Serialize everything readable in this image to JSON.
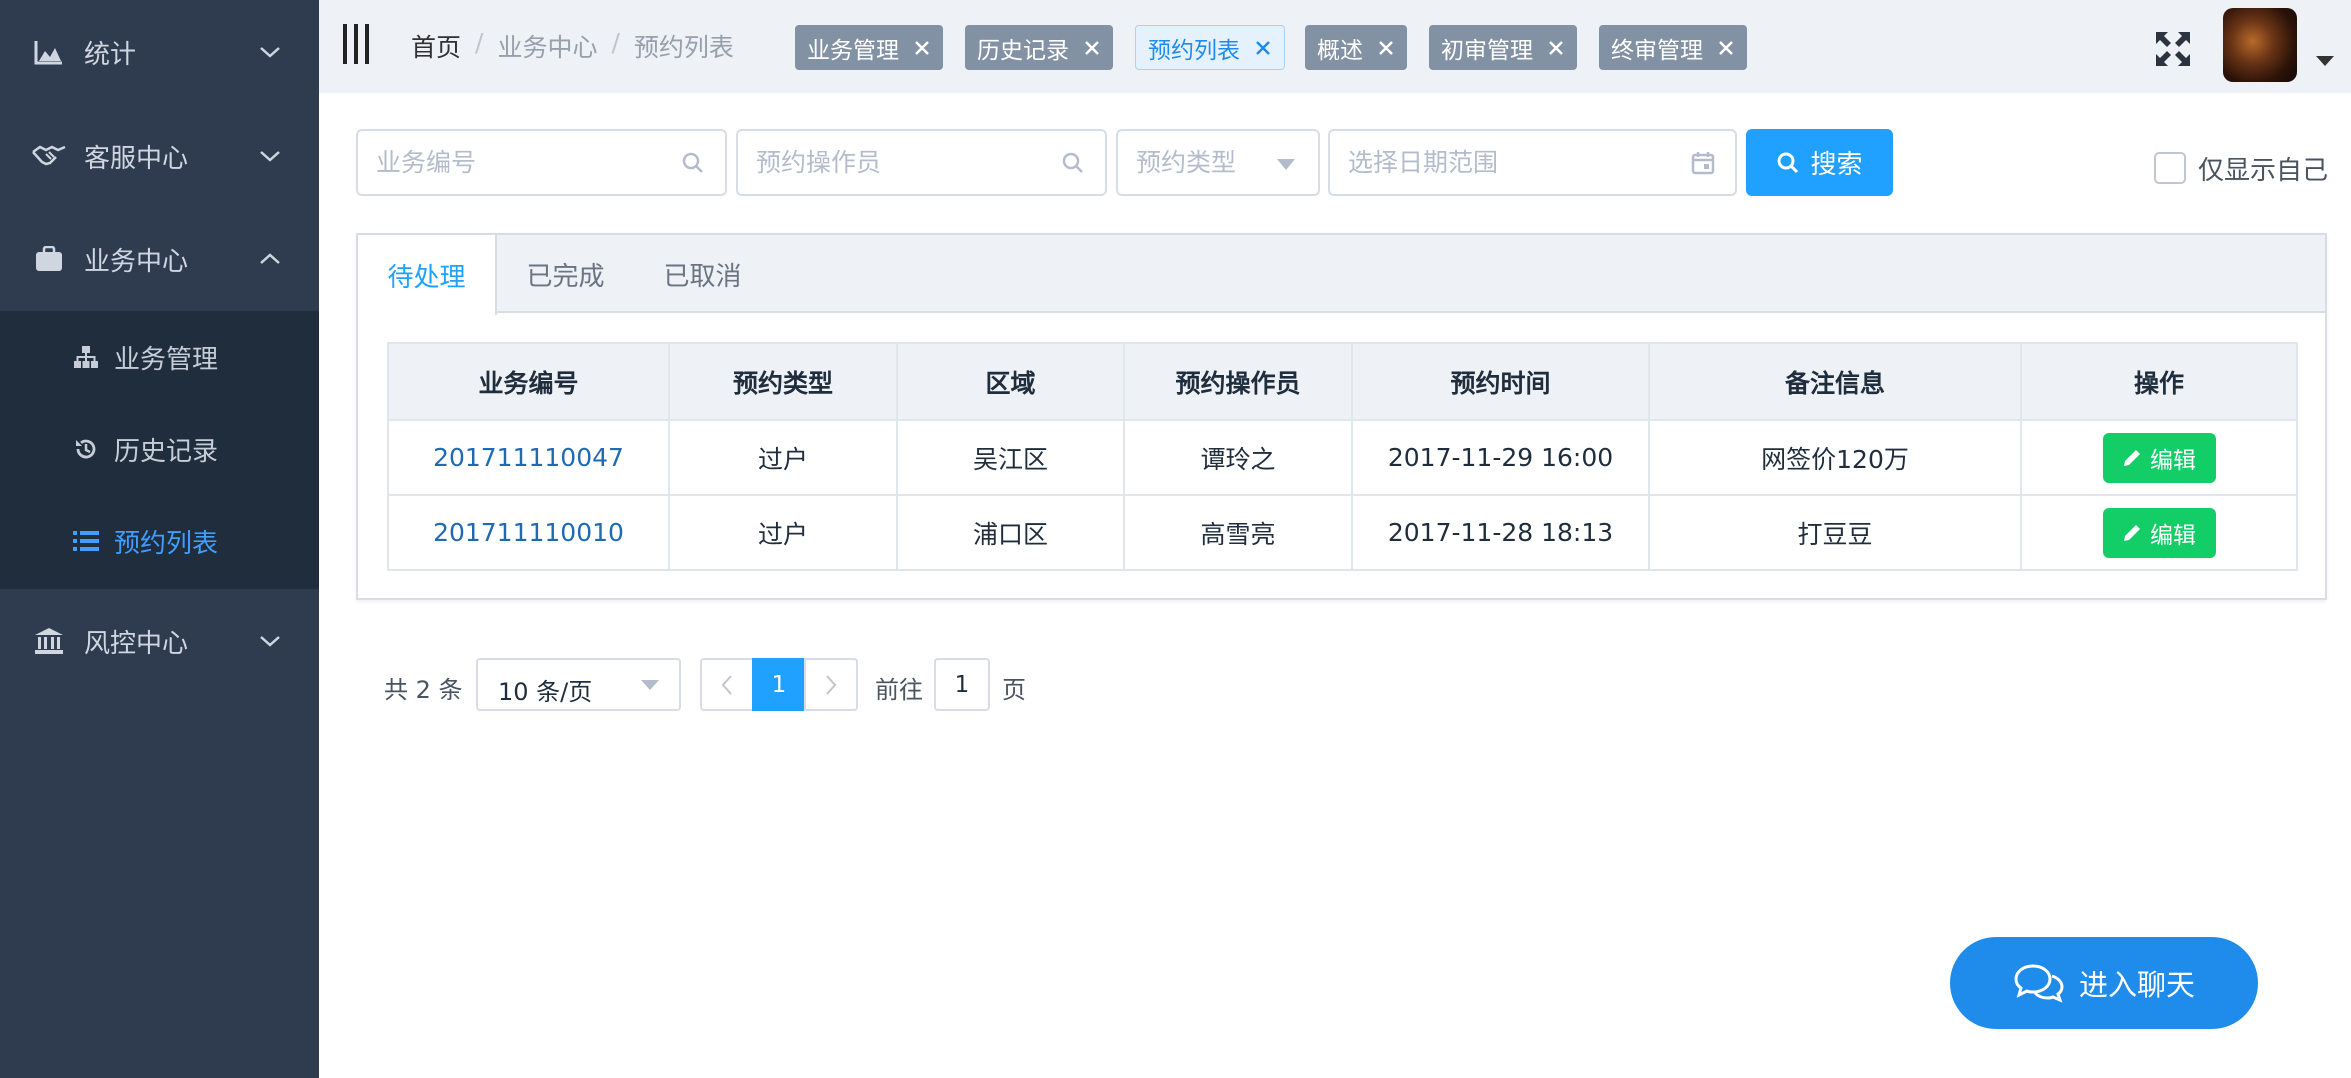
{
  "sidebar": {
    "items": [
      {
        "label": "统计",
        "icon": "area-chart-icon",
        "expanded": false
      },
      {
        "label": "客服中心",
        "icon": "handshake-icon",
        "expanded": false
      },
      {
        "label": "业务中心",
        "icon": "briefcase-icon",
        "expanded": true
      },
      {
        "label": "风控中心",
        "icon": "bank-icon",
        "expanded": false
      }
    ],
    "submenu": [
      {
        "label": "业务管理",
        "icon": "sitemap-icon"
      },
      {
        "label": "历史记录",
        "icon": "history-icon"
      },
      {
        "label": "预约列表",
        "icon": "list-icon",
        "active": true
      }
    ]
  },
  "header": {
    "breadcrumb": [
      "首页",
      "业务中心",
      "预约列表"
    ],
    "breadcrumb_sep": "/",
    "tags": [
      {
        "label": "业务管理"
      },
      {
        "label": "历史记录"
      },
      {
        "label": "预约列表",
        "active": true
      },
      {
        "label": "概述"
      },
      {
        "label": "初审管理"
      },
      {
        "label": "终审管理"
      }
    ]
  },
  "filters": {
    "business_no_placeholder": "业务编号",
    "operator_placeholder": "预约操作员",
    "type_placeholder": "预约类型",
    "date_placeholder": "选择日期范围",
    "search_label": "搜索",
    "only_self_label": "仅显示自己"
  },
  "tabs": [
    "待处理",
    "已完成",
    "已取消"
  ],
  "table": {
    "columns": [
      "业务编号",
      "预约类型",
      "区域",
      "预约操作员",
      "预约时间",
      "备注信息",
      "操作"
    ],
    "rows": [
      [
        "201711110047",
        "过户",
        "吴江区",
        "谭玲之",
        "2017-11-29 16:00",
        "网签价120万"
      ],
      [
        "201711110010",
        "过户",
        "浦口区",
        "高雪亮",
        "2017-11-28 18:13",
        "打豆豆"
      ]
    ],
    "edit_label": "编辑"
  },
  "pagination": {
    "total_text": "共 2 条",
    "page_size": "10 条/页",
    "current_page": "1",
    "goto_label": "前往",
    "goto_value": "1",
    "page_suffix": "页"
  },
  "chat": {
    "label": "进入聊天"
  },
  "colors": {
    "accent": "#20a0ff",
    "success": "#13ce66",
    "sidebar": "#2f3c50"
  }
}
